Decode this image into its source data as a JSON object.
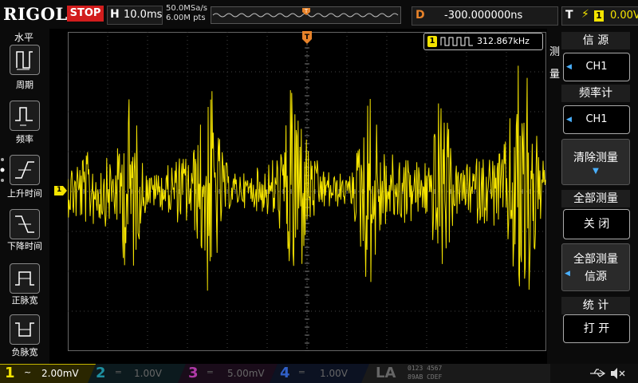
{
  "brand": "RIGOL",
  "status": "STOP",
  "horizontal": {
    "letter": "H",
    "timebase": "10.0ms",
    "sample_rate": "50.0MSa/s",
    "mem_depth": "6.00M pts"
  },
  "trigger_pos": {
    "letter": "D",
    "value": "-300.000000ns"
  },
  "trigger": {
    "letter": "T",
    "edge_icon": "rising-edge-icon",
    "channel": "1",
    "level": "0.00V"
  },
  "left_menu": {
    "title": "水平",
    "items": [
      {
        "label": "周期",
        "icon": "period-icon"
      },
      {
        "label": "频率",
        "icon": "frequency-icon"
      },
      {
        "label": "上升时间",
        "icon": "rise-time-icon"
      },
      {
        "label": "下降时间",
        "icon": "fall-time-icon"
      },
      {
        "label": "正脉宽",
        "icon": "positive-width-icon"
      },
      {
        "label": "负脉宽",
        "icon": "negative-width-icon"
      }
    ]
  },
  "freq_counter": {
    "channel": "1",
    "value": "312.867kHz"
  },
  "channel_marker": "1",
  "trigger_marker": "T",
  "right_menu": {
    "side_label": "测量",
    "source_title": "信 源",
    "source_value": "CH1",
    "freq_title": "频率计",
    "freq_value": "CH1",
    "clear_label": "清除测量",
    "all_title": "全部测量",
    "all_value": "关 闭",
    "all_source_line1": "全部测量",
    "all_source_line2": "信源",
    "stats_title": "统 计",
    "stats_value": "打 开"
  },
  "bottom": {
    "ch1": {
      "num": "1",
      "coupling": "~",
      "scale": "2.00mV",
      "color": "#f5e400"
    },
    "ch2": {
      "num": "2",
      "coupling": "═",
      "scale": "1.00V",
      "color": "#1e8fa0"
    },
    "ch3": {
      "num": "3",
      "coupling": "═",
      "scale": "5.00mV",
      "color": "#b03aa8"
    },
    "ch4": {
      "num": "4",
      "coupling": "═",
      "scale": "1.00V",
      "color": "#3060c8"
    },
    "la": "LA",
    "la_digits_top": "0123 4567",
    "la_digits_bottom": "89AB CDEF"
  },
  "colors": {
    "ch1": "#f5e400",
    "accent": "#e8832a",
    "stop": "#d21d1d",
    "grid": "#555555"
  }
}
